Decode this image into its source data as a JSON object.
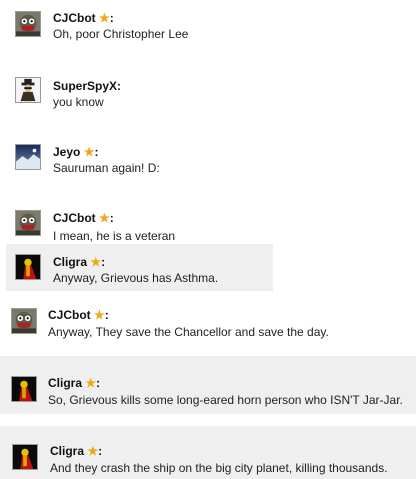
{
  "messages": [
    {
      "user": "CJCbot",
      "star": true,
      "avatar": "muppet-avatar-icon",
      "text": "Oh, poor Christopher Lee"
    },
    {
      "user": "SuperSpyX",
      "star": false,
      "avatar": "spy-avatar-icon",
      "text": "you know"
    },
    {
      "user": "Jeyo",
      "star": true,
      "avatar": "planet-avatar-icon",
      "text": "Sauruman again! D:"
    },
    {
      "user": "CJCbot",
      "star": true,
      "avatar": "muppet-avatar-icon",
      "text": "I mean, he is a veteran"
    },
    {
      "user": "Cligra",
      "star": true,
      "avatar": "red-caped-figure-avatar-icon",
      "text": "Anyway, Grievous has Asthma."
    },
    {
      "user": "CJCbot",
      "star": true,
      "avatar": "muppet-avatar-icon",
      "text": "Anyway, They save the Chancellor and save the day."
    },
    {
      "user": "Cligra",
      "star": true,
      "avatar": "red-caped-figure-avatar-icon",
      "text": "So, Grievous kills some long-eared horn person who ISN'T Jar-Jar."
    },
    {
      "user": "Cligra",
      "star": true,
      "avatar": "red-caped-figure-avatar-icon",
      "text": "And they crash the ship on the big city planet, killing thousands."
    }
  ],
  "separator": ":",
  "colors": {
    "star": "#f0a818",
    "highlight": "#efefef"
  }
}
